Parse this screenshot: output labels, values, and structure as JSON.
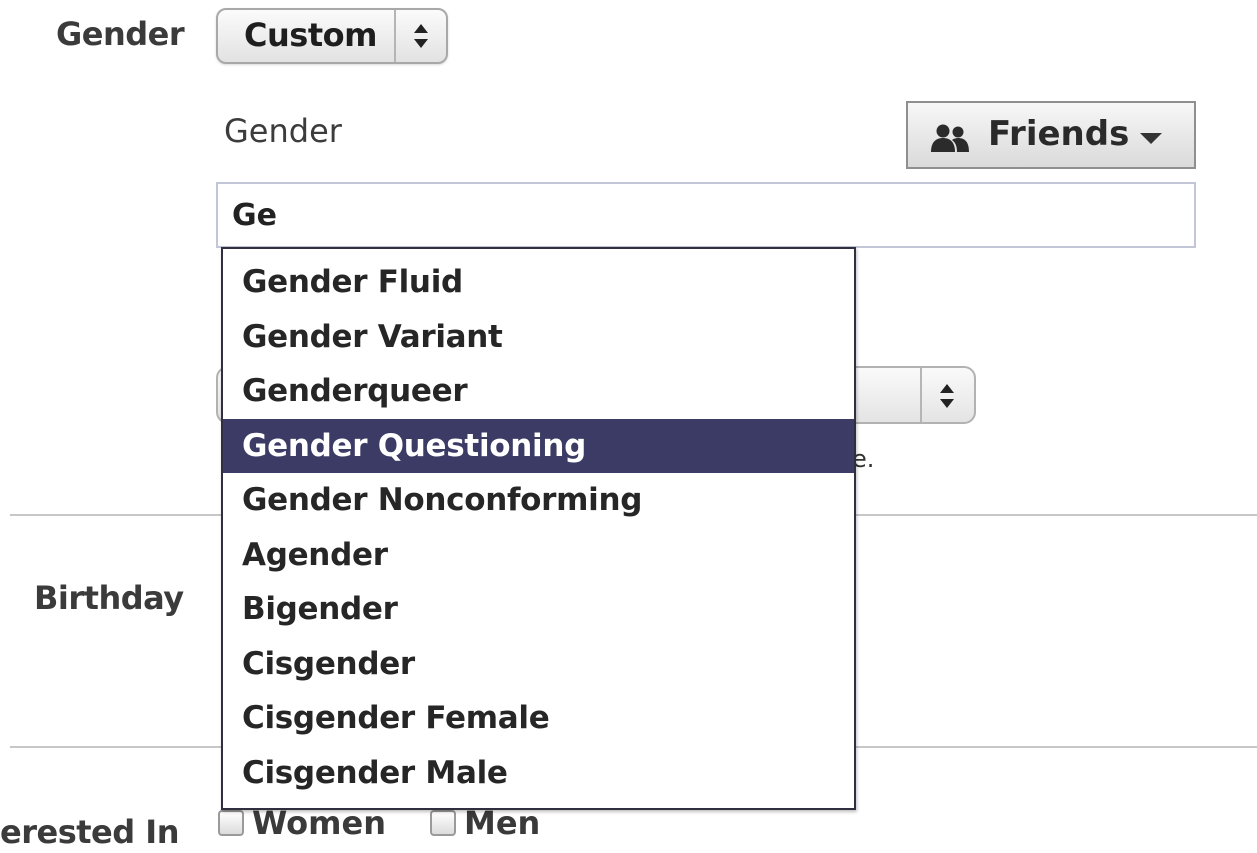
{
  "gender_row": {
    "label": "Gender",
    "select_value": "Custom"
  },
  "custom_gender": {
    "label": "Gender",
    "audience_label": "Friends",
    "audience_icon": "friends-icon",
    "input_value": "Ge"
  },
  "hidden_note_tail": "e.",
  "birthday_row": {
    "label": "Birthday"
  },
  "interested_row": {
    "label": "erested In",
    "options": [
      "Women",
      "Men"
    ]
  },
  "suggestions": {
    "selected_index": 3,
    "selected_color": "#3b3b65",
    "items": [
      "Gender Fluid",
      "Gender Variant",
      "Genderqueer",
      "Gender Questioning",
      "Gender Nonconforming",
      "Agender",
      "Bigender",
      "Cisgender",
      "Cisgender Female",
      "Cisgender Male"
    ]
  }
}
